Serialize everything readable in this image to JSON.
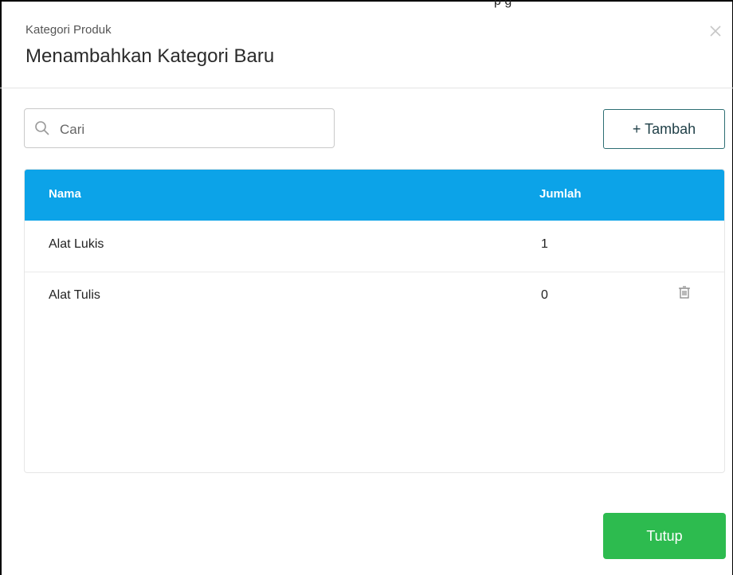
{
  "top_cut_text": "p       g",
  "modal": {
    "subtitle": "Kategori Produk",
    "title": "Menambahkan Kategori Baru"
  },
  "search": {
    "placeholder": "Cari"
  },
  "actions": {
    "add_label": "+ Tambah",
    "close_label": "Tutup"
  },
  "table": {
    "headers": [
      "Nama",
      "Jumlah"
    ],
    "rows": [
      {
        "name": "Alat Lukis",
        "count": "1"
      },
      {
        "name": "Alat Tulis",
        "count": "0"
      }
    ]
  },
  "icons": {
    "search": "search-icon",
    "close": "close-icon",
    "trash": "trash-icon"
  },
  "colors": {
    "accent": "#0ca3e8",
    "primary_button": "#2dbb4f",
    "outline_button": "#2d6e73"
  }
}
